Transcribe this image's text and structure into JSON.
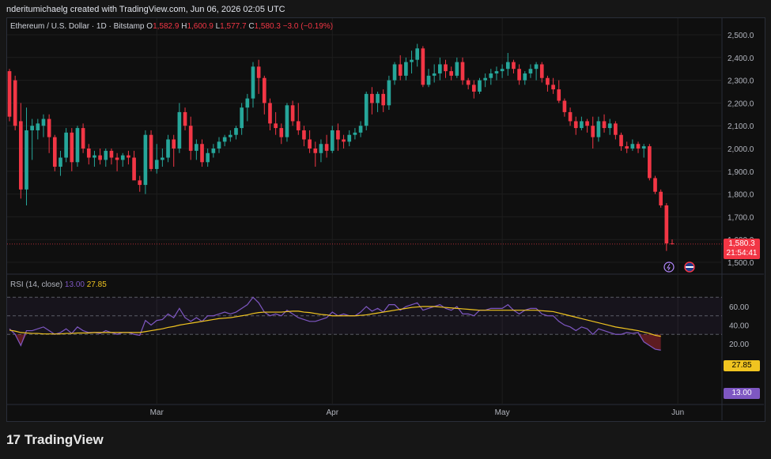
{
  "header": {
    "watermark": "nderitumichaelg created with TradingView.com, Jun 06, 2026 02:05 UTC"
  },
  "legend": {
    "symbol": "Ethereum / U.S. Dollar · 1D · Bitstamp",
    "o_label": "O",
    "o_value": "1,582.9",
    "h_label": "H",
    "h_value": "1,600.9",
    "l_label": "L",
    "l_value": "1,577.7",
    "c_label": "C",
    "c_value": "1,580.3",
    "change": "−3.0 (−0.19%)"
  },
  "last_price": {
    "price": "1,580.3",
    "countdown": "21:54:41"
  },
  "rsi": {
    "title": "RSI (14, close)",
    "value": "13.00",
    "ma_value": "27.85",
    "levels": [
      70,
      50,
      30
    ],
    "y_ticks": [
      "60.00",
      "40.00",
      "20.00"
    ]
  },
  "brand": {
    "name": "TradingView"
  },
  "colors": {
    "up": "#26a69a",
    "down": "#f23645",
    "rsi_line": "#7e57c2",
    "rsi_ma": "#f0c420",
    "background": "#0f0f0f",
    "grid": "#1e1e1e"
  },
  "icons": [
    "lightning-icon",
    "us-flag-icon"
  ],
  "chart_data": {
    "type": "candlestick",
    "title": "Ethereum / U.S. Dollar · 1D · Bitstamp",
    "y_ticks": [
      "2,500.0",
      "2,400.0",
      "2,300.0",
      "2,200.0",
      "2,100.0",
      "2,000.0",
      "1,900.0",
      "1,800.0",
      "1,700.0",
      "1,600.0",
      "1,500.0"
    ],
    "x_ticks": [
      {
        "label": "Mar",
        "index": 26
      },
      {
        "label": "Apr",
        "index": 57
      },
      {
        "label": "May",
        "index": 87
      },
      {
        "label": "Jun",
        "index": 118
      }
    ],
    "ylim": [
      1450,
      2540
    ],
    "ohlc": [
      [
        2340,
        2350,
        2120,
        2140
      ],
      [
        2300,
        2320,
        2080,
        2100
      ],
      [
        2120,
        2200,
        1780,
        1820
      ],
      [
        1820,
        2180,
        1750,
        2080
      ],
      [
        2080,
        2130,
        1950,
        2100
      ],
      [
        2080,
        2130,
        2040,
        2110
      ],
      [
        2100,
        2150,
        2050,
        2130
      ],
      [
        2130,
        2150,
        1980,
        2050
      ],
      [
        2050,
        2060,
        1900,
        1920
      ],
      [
        1920,
        1990,
        1880,
        1960
      ],
      [
        1960,
        2090,
        1940,
        2070
      ],
      [
        2070,
        2090,
        1900,
        1940
      ],
      [
        1940,
        2100,
        1920,
        2090
      ],
      [
        2090,
        2110,
        1980,
        2000
      ],
      [
        2000,
        2020,
        1930,
        1960
      ],
      [
        1960,
        1990,
        1920,
        1970
      ],
      [
        1970,
        2000,
        1930,
        1950
      ],
      [
        1950,
        2000,
        1920,
        1990
      ],
      [
        1990,
        2000,
        1930,
        1960
      ],
      [
        1960,
        1980,
        1900,
        1950
      ],
      [
        1950,
        1980,
        1920,
        1970
      ],
      [
        1970,
        1990,
        1930,
        1960
      ],
      [
        1960,
        1990,
        1870,
        1860
      ],
      [
        1860,
        1880,
        1810,
        1840
      ],
      [
        1840,
        2080,
        1800,
        2060
      ],
      [
        2060,
        2080,
        1900,
        1910
      ],
      [
        1910,
        2020,
        1890,
        1950
      ],
      [
        1950,
        2000,
        1920,
        1960
      ],
      [
        1960,
        2060,
        1940,
        2040
      ],
      [
        2040,
        2060,
        1920,
        2000
      ],
      [
        2000,
        2200,
        1980,
        2160
      ],
      [
        2160,
        2180,
        2080,
        2100
      ],
      [
        2100,
        2140,
        1950,
        1990
      ],
      [
        1990,
        2040,
        1950,
        2020
      ],
      [
        2020,
        2040,
        1920,
        1940
      ],
      [
        1940,
        2000,
        1920,
        1980
      ],
      [
        1980,
        2020,
        1960,
        2000
      ],
      [
        2000,
        2050,
        1980,
        2030
      ],
      [
        2030,
        2060,
        2010,
        2050
      ],
      [
        2050,
        2080,
        2030,
        2060
      ],
      [
        2060,
        2100,
        2040,
        2090
      ],
      [
        2090,
        2200,
        2060,
        2180
      ],
      [
        2180,
        2240,
        2120,
        2220
      ],
      [
        2220,
        2380,
        2180,
        2360
      ],
      [
        2360,
        2390,
        2240,
        2310
      ],
      [
        2310,
        2320,
        2150,
        2200
      ],
      [
        2200,
        2220,
        2080,
        2110
      ],
      [
        2110,
        2160,
        2060,
        2090
      ],
      [
        2090,
        2110,
        2020,
        2050
      ],
      [
        2050,
        2200,
        2030,
        2190
      ],
      [
        2190,
        2210,
        2100,
        2120
      ],
      [
        2120,
        2200,
        2060,
        2080
      ],
      [
        2080,
        2100,
        2010,
        2040
      ],
      [
        2040,
        2080,
        1980,
        2000
      ],
      [
        2000,
        2030,
        1920,
        1980
      ],
      [
        1980,
        2040,
        1940,
        2020
      ],
      [
        2020,
        2060,
        1960,
        1990
      ],
      [
        1990,
        2100,
        1980,
        2080
      ],
      [
        2080,
        2110,
        1990,
        2040
      ],
      [
        2040,
        2060,
        2000,
        2030
      ],
      [
        2030,
        2080,
        2010,
        2060
      ],
      [
        2060,
        2090,
        2040,
        2070
      ],
      [
        2070,
        2120,
        2050,
        2100
      ],
      [
        2100,
        2250,
        2080,
        2240
      ],
      [
        2240,
        2270,
        2150,
        2200
      ],
      [
        2200,
        2250,
        2160,
        2240
      ],
      [
        2240,
        2260,
        2160,
        2190
      ],
      [
        2190,
        2320,
        2170,
        2300
      ],
      [
        2300,
        2380,
        2280,
        2370
      ],
      [
        2370,
        2410,
        2300,
        2320
      ],
      [
        2320,
        2400,
        2300,
        2380
      ],
      [
        2380,
        2430,
        2330,
        2390
      ],
      [
        2390,
        2460,
        2360,
        2440
      ],
      [
        2440,
        2450,
        2270,
        2280
      ],
      [
        2280,
        2350,
        2270,
        2320
      ],
      [
        2320,
        2370,
        2290,
        2330
      ],
      [
        2330,
        2400,
        2300,
        2370
      ],
      [
        2370,
        2390,
        2310,
        2340
      ],
      [
        2340,
        2360,
        2300,
        2320
      ],
      [
        2320,
        2400,
        2310,
        2380
      ],
      [
        2380,
        2400,
        2280,
        2300
      ],
      [
        2300,
        2310,
        2260,
        2280
      ],
      [
        2280,
        2300,
        2220,
        2250
      ],
      [
        2250,
        2310,
        2240,
        2300
      ],
      [
        2300,
        2330,
        2270,
        2310
      ],
      [
        2310,
        2350,
        2280,
        2330
      ],
      [
        2330,
        2360,
        2300,
        2340
      ],
      [
        2340,
        2370,
        2310,
        2350
      ],
      [
        2350,
        2420,
        2320,
        2380
      ],
      [
        2380,
        2390,
        2330,
        2350
      ],
      [
        2350,
        2370,
        2280,
        2300
      ],
      [
        2300,
        2340,
        2280,
        2330
      ],
      [
        2330,
        2370,
        2310,
        2350
      ],
      [
        2350,
        2380,
        2300,
        2370
      ],
      [
        2370,
        2380,
        2290,
        2310
      ],
      [
        2310,
        2320,
        2250,
        2280
      ],
      [
        2280,
        2310,
        2240,
        2260
      ],
      [
        2260,
        2300,
        2200,
        2210
      ],
      [
        2210,
        2220,
        2140,
        2160
      ],
      [
        2160,
        2180,
        2100,
        2120
      ],
      [
        2120,
        2140,
        2060,
        2090
      ],
      [
        2090,
        2140,
        2080,
        2120
      ],
      [
        2120,
        2130,
        2070,
        2100
      ],
      [
        2100,
        2140,
        2000,
        2050
      ],
      [
        2050,
        2140,
        2030,
        2120
      ],
      [
        2120,
        2150,
        2070,
        2090
      ],
      [
        2090,
        2130,
        2060,
        2110
      ],
      [
        2110,
        2120,
        2040,
        2060
      ],
      [
        2060,
        2070,
        1990,
        2010
      ],
      [
        2010,
        2030,
        1980,
        2000
      ],
      [
        2000,
        2040,
        1990,
        2020
      ],
      [
        2020,
        2030,
        1980,
        2000
      ],
      [
        2000,
        2020,
        1960,
        2010
      ],
      [
        2010,
        2020,
        1860,
        1870
      ],
      [
        1870,
        1880,
        1800,
        1810
      ],
      [
        1810,
        1820,
        1740,
        1750
      ],
      [
        1750,
        1760,
        1550,
        1583
      ],
      [
        1582.9,
        1600.9,
        1577.7,
        1580.3
      ]
    ],
    "rsi_values": [
      36,
      30,
      18,
      34,
      34,
      36,
      38,
      34,
      30,
      32,
      36,
      31,
      38,
      34,
      32,
      32,
      31,
      34,
      32,
      30,
      32,
      32,
      30,
      29,
      45,
      40,
      45,
      46,
      52,
      48,
      58,
      48,
      44,
      48,
      44,
      50,
      50,
      52,
      54,
      52,
      54,
      58,
      62,
      70,
      64,
      54,
      50,
      52,
      50,
      56,
      52,
      48,
      46,
      44,
      44,
      46,
      48,
      54,
      50,
      52,
      50,
      50,
      54,
      60,
      55,
      58,
      54,
      62,
      62,
      56,
      60,
      62,
      64,
      56,
      58,
      60,
      62,
      58,
      56,
      60,
      52,
      52,
      50,
      56,
      56,
      58,
      58,
      58,
      62,
      56,
      52,
      56,
      58,
      58,
      52,
      50,
      50,
      44,
      40,
      38,
      34,
      38,
      36,
      30,
      36,
      34,
      32,
      30,
      30,
      32,
      31,
      32,
      22,
      18,
      14,
      13
    ],
    "rsi_ma_values": [
      34.5,
      33.5,
      32,
      31.5,
      31,
      31,
      30.5,
      30.5,
      30.5,
      30.5,
      31,
      31,
      31.5,
      31.5,
      31.5,
      32,
      32,
      32,
      32,
      32,
      32,
      32,
      32,
      32,
      33,
      34,
      35,
      36,
      37.5,
      38.5,
      40,
      41,
      42,
      43,
      44,
      45,
      46,
      47,
      47.5,
      48,
      49,
      50,
      51,
      52.5,
      53.5,
      54,
      54,
      54,
      54,
      54.5,
      55,
      55,
      54,
      53.5,
      52.5,
      51.5,
      51,
      50,
      50,
      50,
      50,
      50,
      50.5,
      51,
      52,
      53,
      54,
      55,
      56,
      57,
      58,
      59,
      59.5,
      60,
      60,
      60,
      59.5,
      59,
      58.5,
      58,
      57.5,
      57,
      56.5,
      56,
      56,
      56,
      56,
      56,
      56,
      56,
      56,
      56,
      56,
      56,
      55.5,
      55,
      54.5,
      53,
      51.5,
      50,
      48.5,
      47,
      45.5,
      44,
      42.5,
      41,
      39.5,
      38,
      37,
      36,
      35,
      34,
      32.5,
      31,
      29,
      27.85
    ]
  }
}
